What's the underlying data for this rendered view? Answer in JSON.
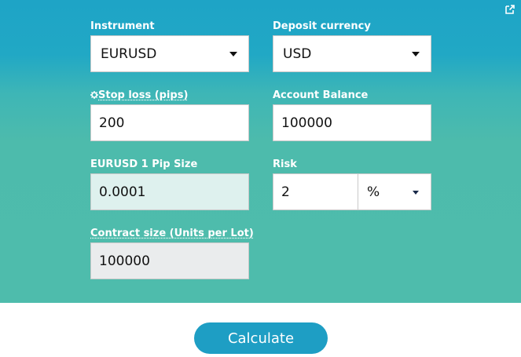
{
  "fields": {
    "instrument": {
      "label": "Instrument",
      "value": "EURUSD"
    },
    "deposit_currency": {
      "label": "Deposit currency",
      "value": "USD"
    },
    "stop_loss": {
      "label": "Stop loss (pips)",
      "icon": "gear-icon",
      "value": "200"
    },
    "account_balance": {
      "label": "Account Balance",
      "value": "100000"
    },
    "pip_size": {
      "label": "EURUSD 1 Pip Size",
      "value": "0.0001"
    },
    "risk": {
      "label": "Risk",
      "value": "2",
      "unit": "%"
    },
    "contract_size": {
      "label": "Contract size (Units per Lot)",
      "value": "100000"
    }
  },
  "calculate_button": {
    "label": "Calculate"
  },
  "colors": {
    "accent": "#1e9ec4",
    "panel_top": "#1ea4c6",
    "panel_bottom": "#4ebcac"
  },
  "icons": {
    "popout": "external-link-icon"
  }
}
